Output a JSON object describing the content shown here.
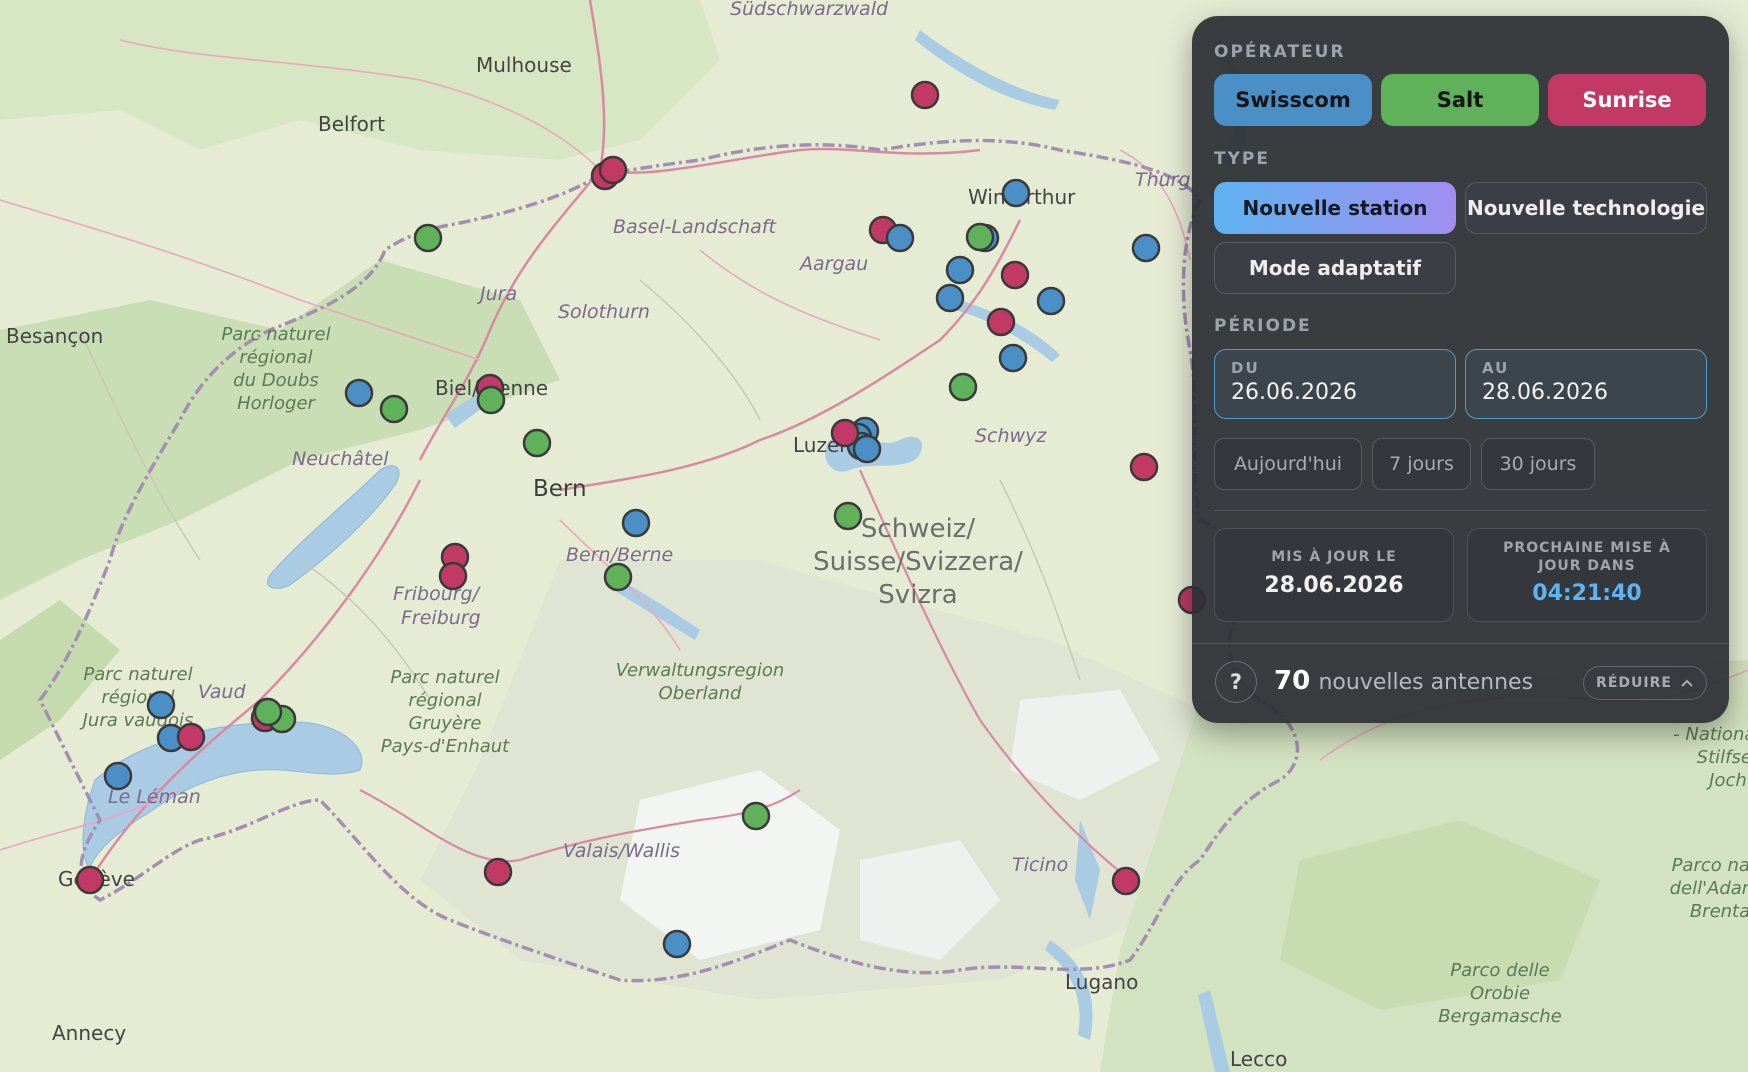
{
  "map": {
    "cities": [
      {
        "name": "Mulhouse",
        "cls": "city"
      },
      {
        "name": "Belfort",
        "cls": "city"
      },
      {
        "name": "Besançon",
        "cls": "city"
      },
      {
        "name": "Bern",
        "cls": "city-lg"
      },
      {
        "name": "Biel/Bienne",
        "cls": "city"
      },
      {
        "name": "Winterthur",
        "cls": "city"
      },
      {
        "name": "Luzern",
        "cls": "city"
      },
      {
        "name": "Genève",
        "cls": "city"
      },
      {
        "name": "Lugano",
        "cls": "city"
      },
      {
        "name": "Annecy",
        "cls": "city"
      },
      {
        "name": "Lecco",
        "cls": "city"
      }
    ],
    "regions": [
      "Südschwarzwald",
      "Basel-Landschaft",
      "Aargau",
      "Jura",
      "Solothurn",
      "Neuchâtel",
      "Bern/Berne",
      "Fribourg/ Freiburg",
      "Vaud",
      "Le Léman",
      "Valais/Wallis",
      "Ticino",
      "Schwyz",
      "Thurg"
    ],
    "country_lines": [
      "Schweiz/",
      "Suisse/Svizzera/",
      "Svizra"
    ],
    "parks": [
      "Parc naturel régional du Doubs Horloger",
      "Parc naturel régional Jura vaudois",
      "Parc naturel régional Gruyère Pays-d'Enhaut",
      "Verwaltungsregion Oberland",
      "Parco delle Orobie Bergamasche",
      "Parco naturale dell'Adamello Brenta",
      "Nationalpark Stilfser Joch"
    ]
  },
  "operators": {
    "swisscom": {
      "color": "#4a90c7"
    },
    "salt": {
      "color": "#5fb25a"
    },
    "sunrise": {
      "color": "#c23966"
    }
  },
  "panel": {
    "operator_title": "OPÉRATEUR",
    "operator_buttons": [
      "Swisscom",
      "Salt",
      "Sunrise"
    ],
    "type_title": "TYPE",
    "type_buttons": {
      "new_station": "Nouvelle station",
      "new_tech": "Nouvelle technologie",
      "adaptive": "Mode adaptatif"
    },
    "period_title": "PÉRIODE",
    "from": {
      "label": "DU",
      "value": "26.06.2026"
    },
    "to": {
      "label": "AU",
      "value": "28.06.2026"
    },
    "quick": [
      "Aujourd'hui",
      "7 jours",
      "30 jours"
    ],
    "updated": {
      "label": "MIS À JOUR LE",
      "value": "28.06.2026"
    },
    "next": {
      "label": "PROCHAINE MISE À JOUR DANS",
      "value": "04:21:40"
    },
    "help": "?",
    "count": "70",
    "count_label": "nouvelles antennes",
    "collapse": "RÉDUIRE"
  }
}
